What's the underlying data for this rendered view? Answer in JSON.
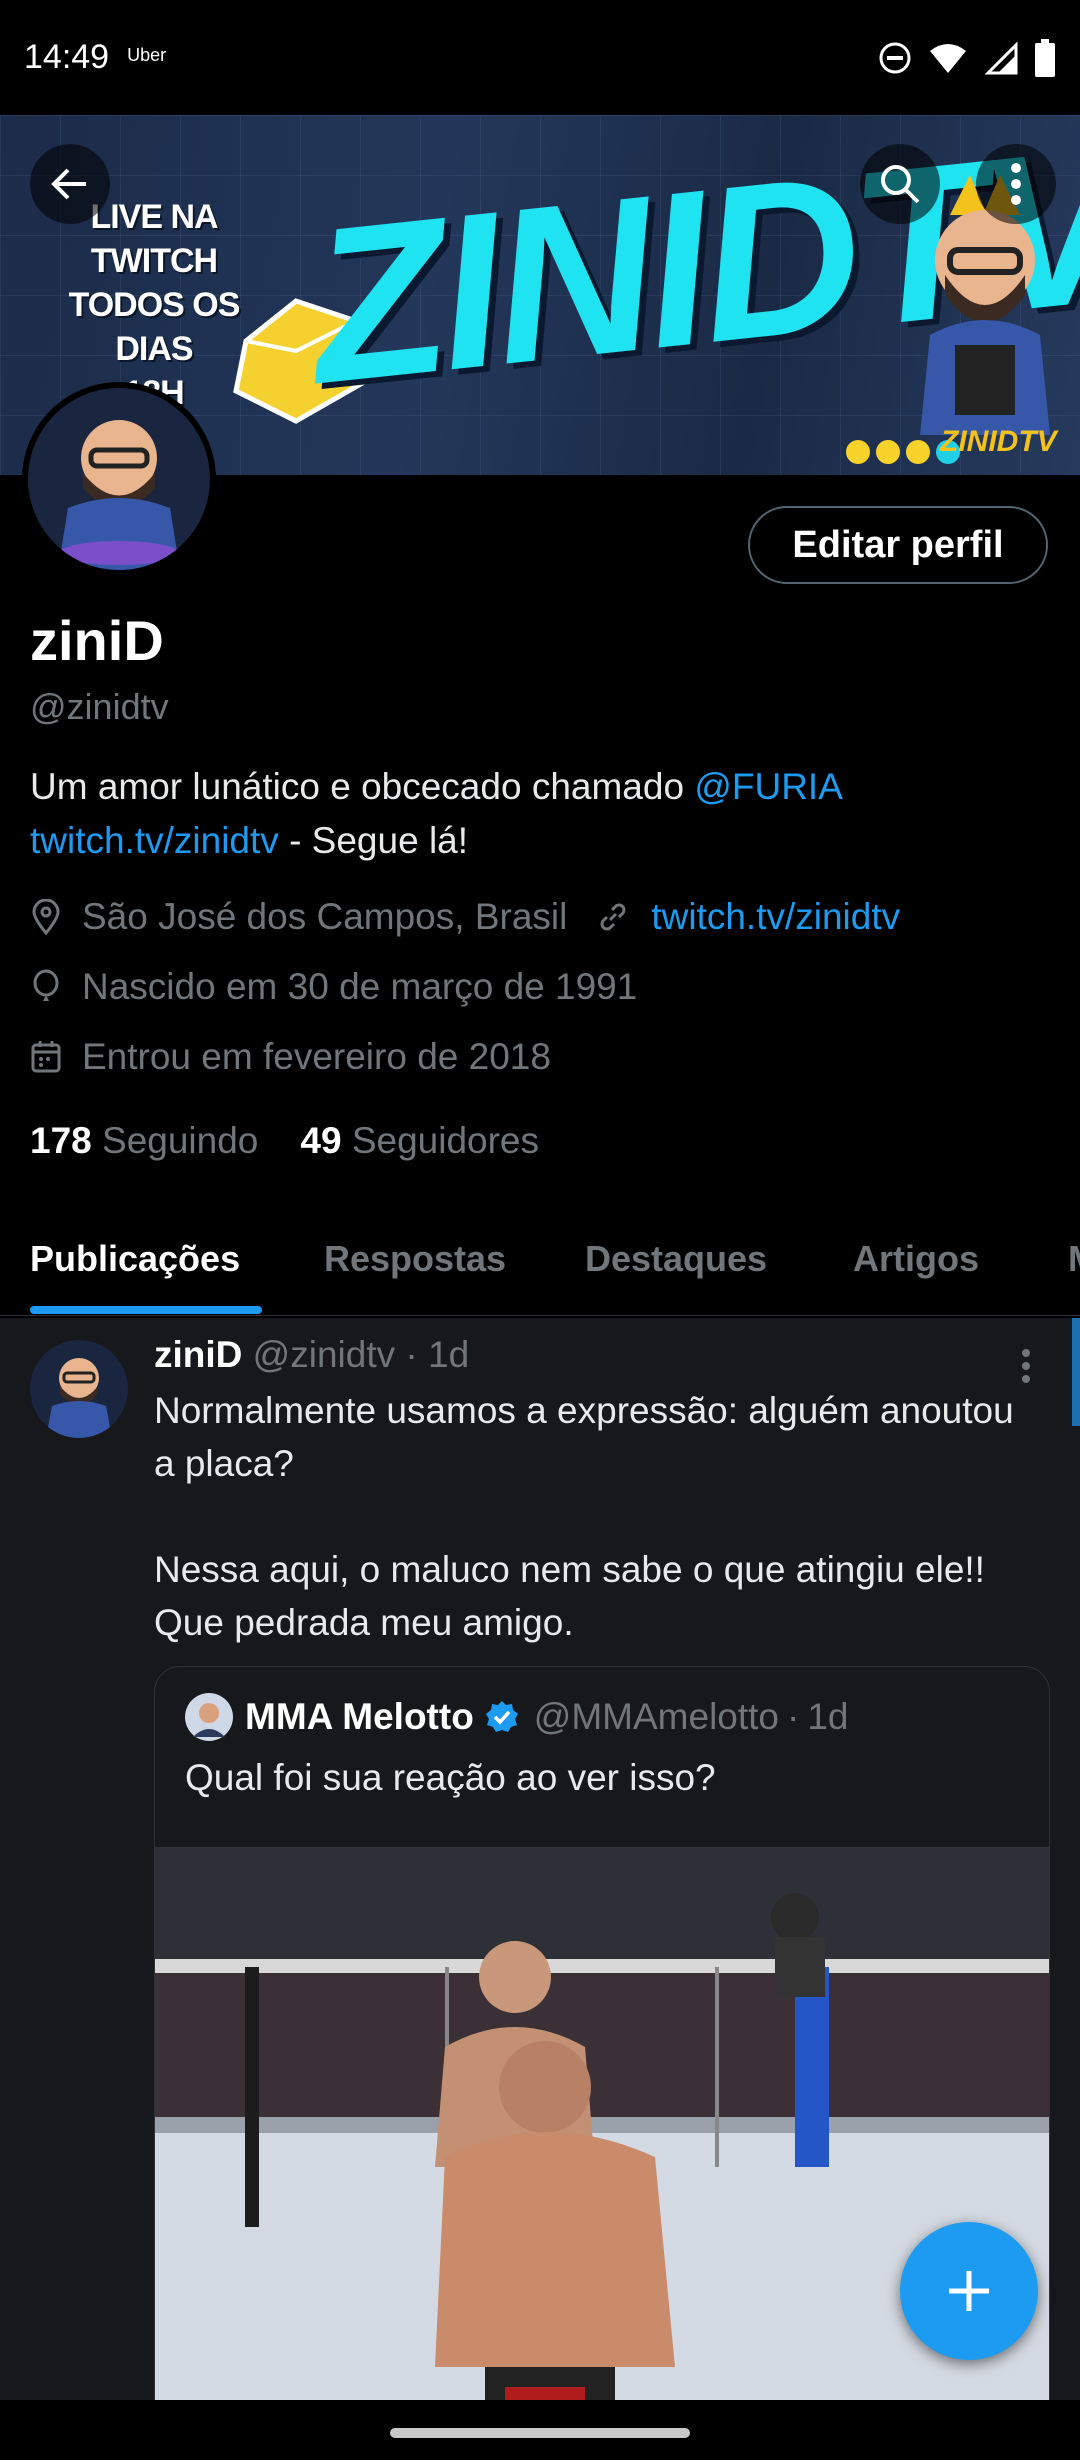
{
  "status_bar": {
    "time": "14:49",
    "app": "Uber",
    "icons": [
      "dnd-icon",
      "wifi-icon",
      "signal-icon",
      "battery-icon"
    ]
  },
  "banner": {
    "text_lines": [
      "LIVE NA TWITCH",
      "TODOS OS DIAS",
      "18H"
    ],
    "logo": "ZINIDTV",
    "sub_logo": "ZINIDTV"
  },
  "toolbar": {
    "icons": [
      "back-arrow-icon",
      "search-icon",
      "more-vert-icon"
    ]
  },
  "profile": {
    "edit_button": "Editar perfil",
    "name": "ziniD",
    "handle": "@zinidtv",
    "bio_text": "Um amor lunático e obcecado chamado ",
    "bio_mention": "@FURIA",
    "bio_link": "twitch.tv/zinidtv",
    "bio_suffix": " - Segue lá!",
    "location": "São José dos Campos, Brasil",
    "website": "twitch.tv/zinidtv",
    "birth": "Nascido em 30 de março de 1991",
    "joined": "Entrou em fevereiro de 2018",
    "following_count": "178",
    "following_label": "Seguindo",
    "followers_count": "49",
    "followers_label": "Seguidores"
  },
  "tabs": [
    {
      "label": "Publicações",
      "active": true
    },
    {
      "label": "Respostas"
    },
    {
      "label": "Destaques"
    },
    {
      "label": "Artigos"
    },
    {
      "label": "M"
    }
  ],
  "tweet": {
    "name": "ziniD",
    "handle": "@zinidtv",
    "time": "1d",
    "text": "Normalmente usamos a expressão: alguém anoutou a placa?\n\nNessa aqui, o maluco nem sabe o que atingiu ele!! Que pedrada meu amigo.",
    "quote": {
      "name": "MMA Melotto",
      "handle": "@MMAmelotto",
      "time": "1d",
      "text": "Qual foi sua reação ao ver isso?"
    }
  },
  "colors": {
    "accent": "#1d9bf0",
    "background": "#000000",
    "muted": "#71767b"
  }
}
